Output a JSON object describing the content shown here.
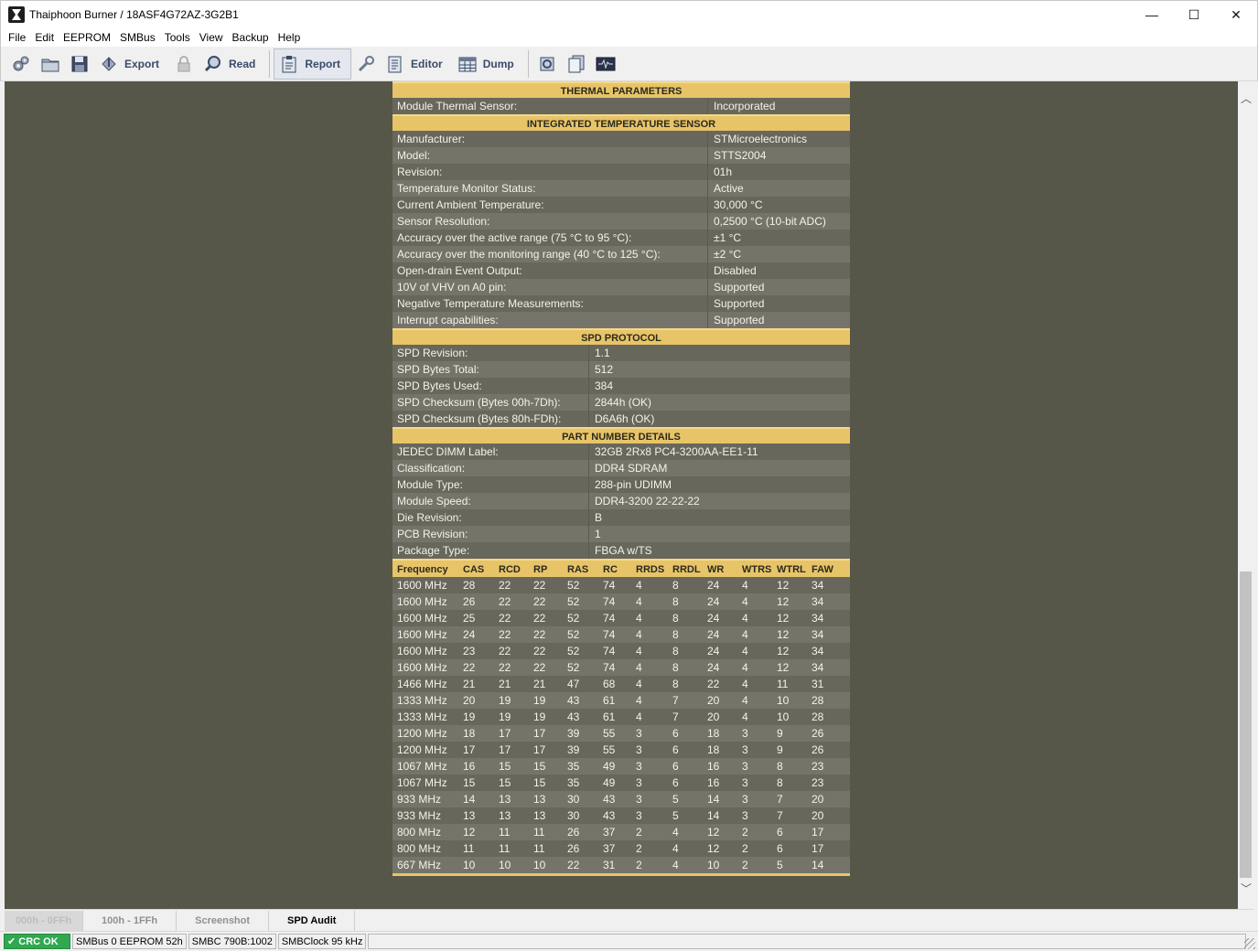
{
  "window": {
    "title": "Thaiphoon Burner / 18ASF4G72AZ-3G2B1",
    "controls": {
      "minimize": "—",
      "maximize": "☐",
      "close": "✕"
    }
  },
  "menu": [
    "File",
    "Edit",
    "EEPROM",
    "SMBus",
    "Tools",
    "View",
    "Backup",
    "Help"
  ],
  "toolbar": {
    "export_label": "Export",
    "read_label": "Read",
    "report_label": "Report",
    "editor_label": "Editor",
    "dump_label": "Dump"
  },
  "thermal": {
    "heading": "THERMAL PARAMETERS",
    "rows": [
      {
        "key": "Module Thermal Sensor:",
        "value": "Incorporated"
      }
    ]
  },
  "sensor": {
    "heading": "INTEGRATED TEMPERATURE SENSOR",
    "rows": [
      {
        "key": "Manufacturer:",
        "value": "STMicroelectronics"
      },
      {
        "key": "Model:",
        "value": "STTS2004"
      },
      {
        "key": "Revision:",
        "value": "01h"
      },
      {
        "key": "Temperature Monitor Status:",
        "value": "Active"
      },
      {
        "key": "Current Ambient Temperature:",
        "value": "30,000 °C"
      },
      {
        "key": "Sensor Resolution:",
        "value": "0,2500 °C (10-bit ADC)"
      },
      {
        "key": "Accuracy over the active range (75 °C to 95 °C):",
        "value": "±1 °C"
      },
      {
        "key": "Accuracy over the monitoring range (40 °C to 125 °C):",
        "value": "±2 °C"
      },
      {
        "key": "Open-drain Event Output:",
        "value": "Disabled"
      },
      {
        "key": "10V of VHV on A0 pin:",
        "value": "Supported"
      },
      {
        "key": "Negative Temperature Measurements:",
        "value": "Supported"
      },
      {
        "key": "Interrupt capabilities:",
        "value": "Supported"
      }
    ]
  },
  "spd": {
    "heading": "SPD PROTOCOL",
    "rows": [
      {
        "key": "SPD Revision:",
        "value": "1.1"
      },
      {
        "key": "SPD Bytes Total:",
        "value": "512"
      },
      {
        "key": "SPD Bytes Used:",
        "value": "384"
      },
      {
        "key": "SPD Checksum (Bytes 00h-7Dh):",
        "value": "2844h (OK)"
      },
      {
        "key": "SPD Checksum (Bytes 80h-FDh):",
        "value": "D6A6h (OK)"
      }
    ]
  },
  "part": {
    "heading": "PART NUMBER DETAILS",
    "rows": [
      {
        "key": "JEDEC DIMM Label:",
        "value": "32GB 2Rx8 PC4-3200AA-EE1-11"
      },
      {
        "key": "Classification:",
        "value": "DDR4 SDRAM"
      },
      {
        "key": "Module Type:",
        "value": "288-pin UDIMM"
      },
      {
        "key": "Module Speed:",
        "value": "DDR4-3200 22-22-22"
      },
      {
        "key": "Die Revision:",
        "value": "B"
      },
      {
        "key": "PCB Revision:",
        "value": "1"
      },
      {
        "key": "Package Type:",
        "value": "FBGA w/TS"
      }
    ]
  },
  "timings": {
    "headers": [
      "Frequency",
      "CAS",
      "RCD",
      "RP",
      "RAS",
      "RC",
      "RRDS",
      "RRDL",
      "WR",
      "WTRS",
      "WTRL",
      "FAW"
    ],
    "rows": [
      [
        "1600 MHz",
        "28",
        "22",
        "22",
        "52",
        "74",
        "4",
        "8",
        "24",
        "4",
        "12",
        "34"
      ],
      [
        "1600 MHz",
        "26",
        "22",
        "22",
        "52",
        "74",
        "4",
        "8",
        "24",
        "4",
        "12",
        "34"
      ],
      [
        "1600 MHz",
        "25",
        "22",
        "22",
        "52",
        "74",
        "4",
        "8",
        "24",
        "4",
        "12",
        "34"
      ],
      [
        "1600 MHz",
        "24",
        "22",
        "22",
        "52",
        "74",
        "4",
        "8",
        "24",
        "4",
        "12",
        "34"
      ],
      [
        "1600 MHz",
        "23",
        "22",
        "22",
        "52",
        "74",
        "4",
        "8",
        "24",
        "4",
        "12",
        "34"
      ],
      [
        "1600 MHz",
        "22",
        "22",
        "22",
        "52",
        "74",
        "4",
        "8",
        "24",
        "4",
        "12",
        "34"
      ],
      [
        "1466 MHz",
        "21",
        "21",
        "21",
        "47",
        "68",
        "4",
        "8",
        "22",
        "4",
        "11",
        "31"
      ],
      [
        "1333 MHz",
        "20",
        "19",
        "19",
        "43",
        "61",
        "4",
        "7",
        "20",
        "4",
        "10",
        "28"
      ],
      [
        "1333 MHz",
        "19",
        "19",
        "19",
        "43",
        "61",
        "4",
        "7",
        "20",
        "4",
        "10",
        "28"
      ],
      [
        "1200 MHz",
        "18",
        "17",
        "17",
        "39",
        "55",
        "3",
        "6",
        "18",
        "3",
        "9",
        "26"
      ],
      [
        "1200 MHz",
        "17",
        "17",
        "17",
        "39",
        "55",
        "3",
        "6",
        "18",
        "3",
        "9",
        "26"
      ],
      [
        "1067 MHz",
        "16",
        "15",
        "15",
        "35",
        "49",
        "3",
        "6",
        "16",
        "3",
        "8",
        "23"
      ],
      [
        "1067 MHz",
        "15",
        "15",
        "15",
        "35",
        "49",
        "3",
        "6",
        "16",
        "3",
        "8",
        "23"
      ],
      [
        "933 MHz",
        "14",
        "13",
        "13",
        "30",
        "43",
        "3",
        "5",
        "14",
        "3",
        "7",
        "20"
      ],
      [
        "933 MHz",
        "13",
        "13",
        "13",
        "30",
        "43",
        "3",
        "5",
        "14",
        "3",
        "7",
        "20"
      ],
      [
        "800 MHz",
        "12",
        "11",
        "11",
        "26",
        "37",
        "2",
        "4",
        "12",
        "2",
        "6",
        "17"
      ],
      [
        "800 MHz",
        "11",
        "11",
        "11",
        "26",
        "37",
        "2",
        "4",
        "12",
        "2",
        "6",
        "17"
      ],
      [
        "667 MHz",
        "10",
        "10",
        "10",
        "22",
        "31",
        "2",
        "4",
        "10",
        "2",
        "5",
        "14"
      ]
    ]
  },
  "tabs": [
    "000h - 0FFh",
    "100h - 1FFh",
    "Screenshot",
    "SPD Audit"
  ],
  "status": {
    "crc": "CRC OK",
    "smbus": "SMBus 0 EEPROM 52h",
    "smbc": "SMBC 790B:1002",
    "clock": "SMBClock 95 kHz"
  }
}
